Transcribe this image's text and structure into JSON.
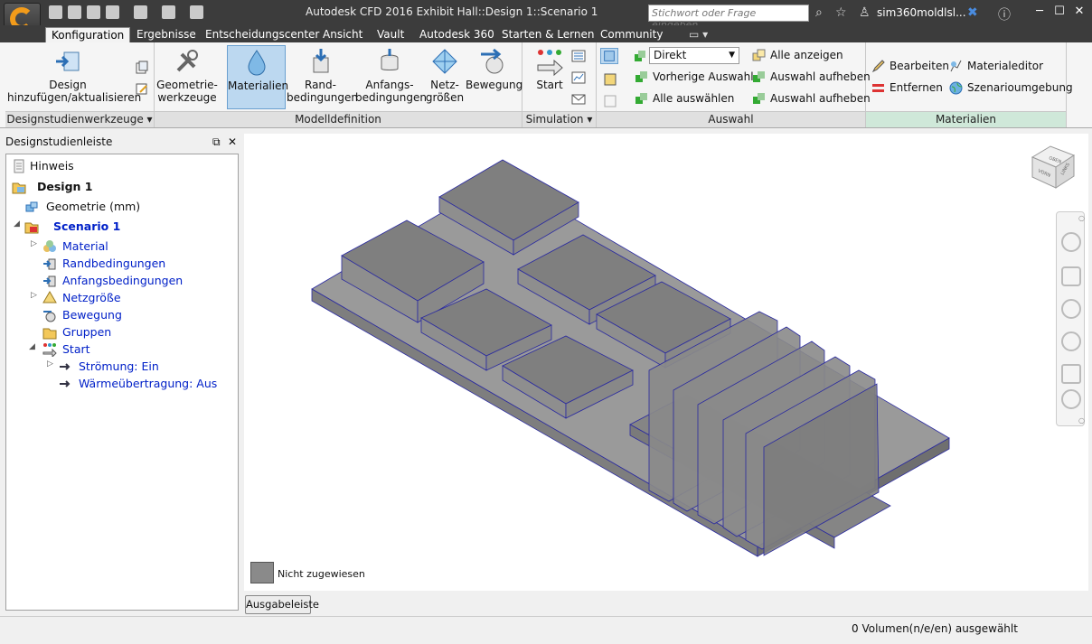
{
  "title": "Autodesk CFD 2016   Exhibit Hall::Design 1::Scenario 1",
  "search": {
    "placeholder": "Stichwort oder Frage eingeben"
  },
  "user": {
    "name": "sim360moldlsl..."
  },
  "tabs": [
    "Konfiguration",
    "Ergebnisse",
    "Entscheidungscenter",
    "Ansicht",
    "Vault",
    "Autodesk 360",
    "Starten & Lernen",
    "Community"
  ],
  "ribbon": {
    "designstudie": {
      "btn1": "Design",
      "btn1b": "hinzufügen/aktualisieren",
      "label": "Designstudienwerkzeuge ▾"
    },
    "modell": {
      "geo": "Geometrie-",
      "geob": "werkzeuge",
      "mat": "Materialien",
      "rand": "Rand-",
      "randb": "bedingungen",
      "anf": "Anfangs-",
      "anfb": "bedingungen",
      "netz": "Netz-",
      "netzb": "größen",
      "bew": "Bewegung",
      "label": "Modelldefinition"
    },
    "simulation": {
      "start": "Start",
      "label": "Simulation ▾"
    },
    "auswahl": {
      "direkt": "Direkt",
      "vorherige": "Vorherige Auswahl",
      "alle_auswaehlen": "Alle auswählen",
      "alle_anzeigen": "Alle anzeigen",
      "auswahl_aufheben1": "Auswahl aufheben",
      "auswahl_aufheben2": "Auswahl aufheben",
      "label": "Auswahl"
    },
    "materialien": {
      "bearbeiten": "Bearbeiten",
      "entfernen": "Entfernen",
      "editor": "Materialeditor",
      "umgebung": "Szenarioumgebung",
      "label": "Materialien"
    }
  },
  "sidebar": {
    "title": "Designstudienleiste",
    "tree": {
      "hinweis": "Hinweis",
      "design": "Design 1",
      "geometrie": "Geometrie (mm)",
      "scenario": "Scenario 1",
      "material": "Material",
      "randbedingungen": "Randbedingungen",
      "anfangsbedingungen": "Anfangsbedingungen",
      "netzgroesse": "Netzgröße",
      "bewegung": "Bewegung",
      "gruppen": "Gruppen",
      "start": "Start",
      "stroemung": "Strömung: Ein",
      "waerme": "Wärmeübertragung: Aus"
    }
  },
  "viewport": {
    "legend_label": "Nicht zugewiesen",
    "cube_labels": [
      "OBEN",
      "LINKS",
      "VORN"
    ]
  },
  "output_button": "Ausgabeleiste",
  "status": "0 Volumen(n/e/en) ausgewählt"
}
